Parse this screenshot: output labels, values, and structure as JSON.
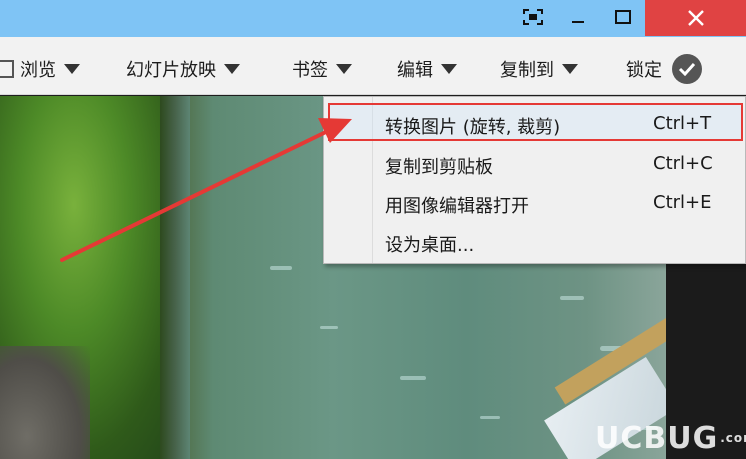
{
  "window": {
    "controls": [
      {
        "name": "fullscreen",
        "icon": "fullscreen-icon"
      },
      {
        "name": "minimize",
        "icon": "minimize-icon"
      },
      {
        "name": "maximize",
        "icon": "maximize-icon"
      },
      {
        "name": "close",
        "icon": "close-icon"
      }
    ],
    "titlebar_color": "#7fc4f5",
    "close_color": "#e04343"
  },
  "toolbar": {
    "browse": "浏览",
    "slideshow": "幻灯片放映",
    "bookmark": "书签",
    "edit": "编辑",
    "copy_to": "复制到",
    "lock": "锁定"
  },
  "menu": {
    "items": [
      {
        "label": "转换图片 (旋转, 裁剪)",
        "shortcut": "Ctrl+T",
        "highlighted": true
      },
      {
        "label": "复制到剪贴板",
        "shortcut": "Ctrl+C"
      },
      {
        "label": "用图像编辑器打开",
        "shortcut": "Ctrl+E"
      },
      {
        "label": "设为桌面...",
        "shortcut": ""
      }
    ],
    "highlight_color": "#e53935"
  },
  "watermark": {
    "text": "UCBUG",
    "suffix": ".com"
  }
}
